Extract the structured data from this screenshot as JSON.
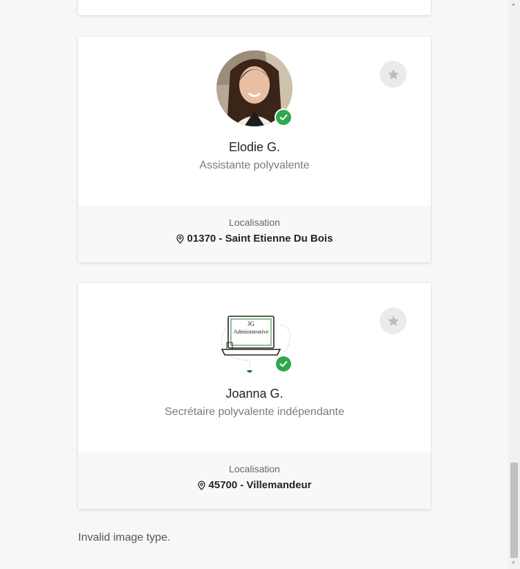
{
  "profiles": [
    {
      "name": "Elodie G.",
      "role": "Assistante polyvalente",
      "location_label": "Localisation",
      "location_value": "01370 - Saint Etienne Du Bois",
      "verified": true,
      "favorite_icon": "star-icon"
    },
    {
      "name": "Joanna G.",
      "role": "Secrétaire polyvalente indépendante",
      "location_label": "Localisation",
      "location_value": "45700 - Villemandeur",
      "verified": true,
      "favorite_icon": "star-icon",
      "logo_text": [
        "JG",
        "Administrative"
      ]
    }
  ],
  "footer": {
    "message": "Invalid image type."
  },
  "colors": {
    "verified": "#2fa84f",
    "background": "#f7f7f7",
    "card_footer": "#f8f8f8"
  }
}
